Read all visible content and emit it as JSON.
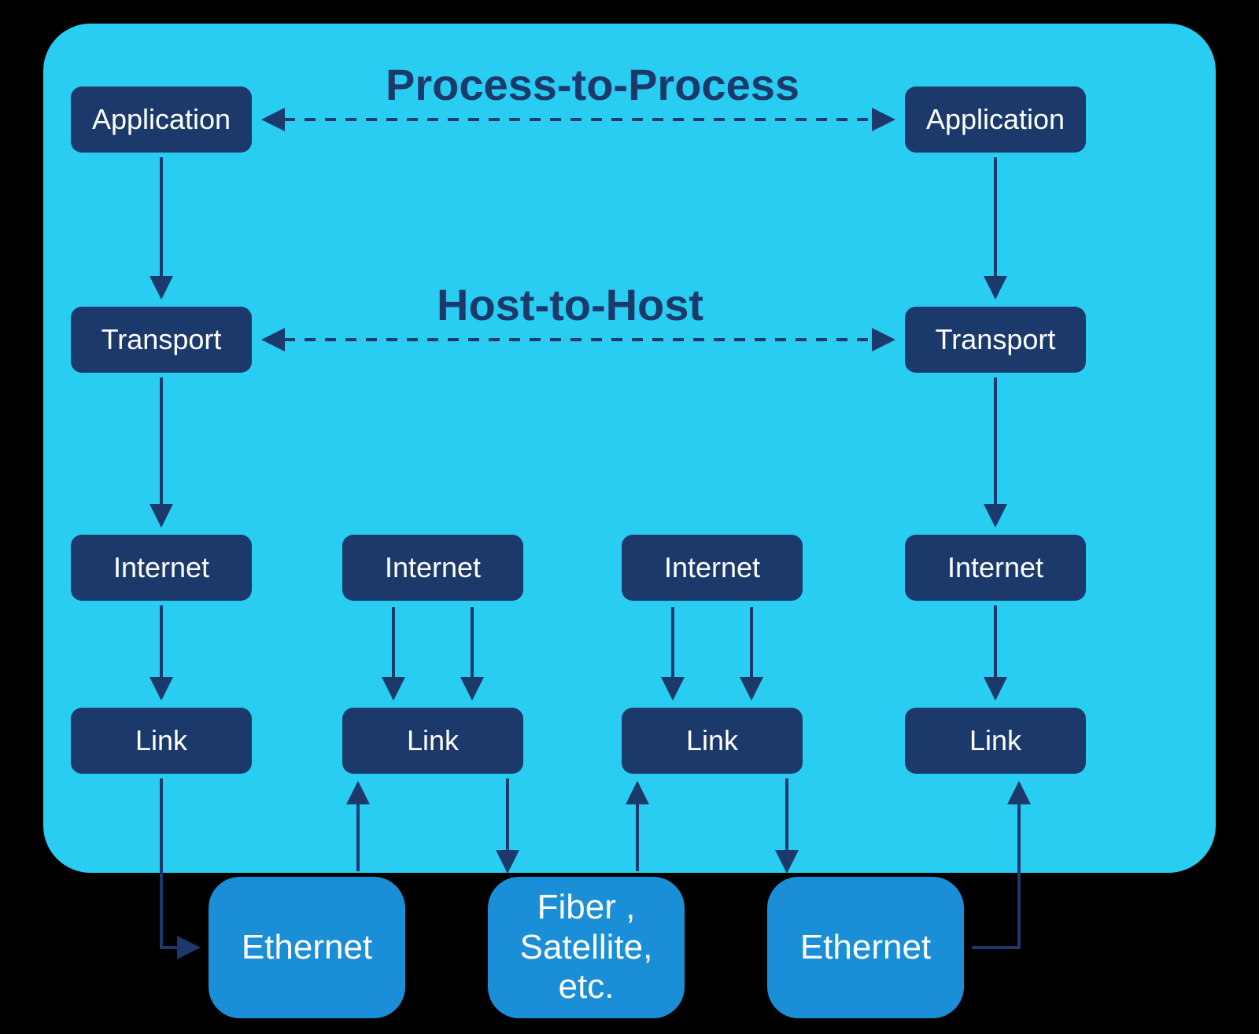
{
  "labels": {
    "process_to_process": "Process-to-Process",
    "host_to_host": "Host-to-Host"
  },
  "columns": {
    "left": {
      "application": "Application",
      "transport": "Transport",
      "internet": "Internet",
      "link": "Link"
    },
    "mid1": {
      "internet": "Internet",
      "link": "Link"
    },
    "mid2": {
      "internet": "Internet",
      "link": "Link"
    },
    "right": {
      "application": "Application",
      "transport": "Transport",
      "internet": "Internet",
      "link": "Link"
    }
  },
  "media": {
    "ethernet1": "Ethernet",
    "fiber": "Fiber , Satellite, etc.",
    "ethernet2": "Ethernet"
  },
  "colors": {
    "panel": "#29cdf2",
    "layer_box": "#1b3a6b",
    "medium_box": "#1a8ed6",
    "arrow": "#1b3a6b"
  }
}
